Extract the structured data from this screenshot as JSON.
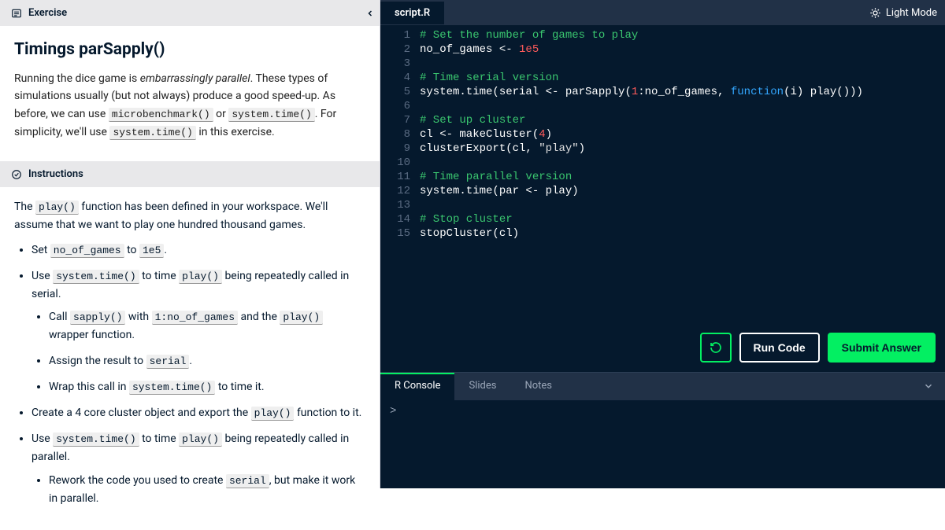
{
  "left": {
    "exercise_label": "Exercise",
    "title": "Timings parSapply()",
    "desc_parts": {
      "p1a": "Running the dice game is ",
      "p1em": "embarrassingly parallel",
      "p1b": ". These types of simulations usually (but not always) produce a good speed-up. As before, we can use ",
      "c1": "microbenchmark()",
      "p1c": " or ",
      "c2": "system.time()",
      "p1d": ". For simplicity, we'll use ",
      "c3": "system.time()",
      "p1e": " in this exercise."
    },
    "instructions_label": "Instructions",
    "intro_a": "The ",
    "intro_c1": "play()",
    "intro_b": " function has been defined in your workspace. We'll assume that we want to play one hundred thousand games.",
    "li1_a": "Set ",
    "li1_c1": "no_of_games",
    "li1_b": " to ",
    "li1_c2": "1e5",
    "li1_c": ".",
    "li2_a": "Use ",
    "li2_c1": "system.time()",
    "li2_b": " to time ",
    "li2_c2": "play()",
    "li2_c": " being repeatedly called in serial.",
    "li2s1_a": "Call ",
    "li2s1_c1": "sapply()",
    "li2s1_b": " with ",
    "li2s1_c2": "1:no_of_games",
    "li2s1_c": " and the ",
    "li2s1_c3": "play()",
    "li2s1_d": " wrapper function.",
    "li2s2_a": "Assign the result to ",
    "li2s2_c1": "serial",
    "li2s2_b": ".",
    "li2s3_a": "Wrap this call in ",
    "li2s3_c1": "system.time()",
    "li2s3_b": " to time it.",
    "li3_a": "Create a 4 core cluster object and export the ",
    "li3_c1": "play()",
    "li3_b": " function to it.",
    "li4_a": "Use ",
    "li4_c1": "system.time()",
    "li4_b": " to time ",
    "li4_c2": "play()",
    "li4_c": " being repeatedly called in parallel.",
    "li4s1_a": "Rework the code you used to create ",
    "li4s1_c1": "serial",
    "li4s1_b": ", but make it work in parallel."
  },
  "editor": {
    "filename": "script.R",
    "light_mode": "Light Mode",
    "lines": [
      [
        {
          "t": "# Set the number of games to play",
          "c": "tok-comment"
        }
      ],
      [
        {
          "t": "no_of_games <- "
        },
        {
          "t": "1e5",
          "c": "tok-num"
        }
      ],
      [],
      [
        {
          "t": "# Time serial version",
          "c": "tok-comment"
        }
      ],
      [
        {
          "t": "system.time(serial <- parSapply("
        },
        {
          "t": "1",
          "c": "tok-num"
        },
        {
          "t": ":no_of_games, "
        },
        {
          "t": "function",
          "c": "tok-kw"
        },
        {
          "t": "(i) play()))"
        }
      ],
      [],
      [
        {
          "t": "# Set up cluster",
          "c": "tok-comment"
        }
      ],
      [
        {
          "t": "cl <- makeCluster("
        },
        {
          "t": "4",
          "c": "tok-num"
        },
        {
          "t": ")"
        }
      ],
      [
        {
          "t": "clusterExport(cl, "
        },
        {
          "t": "\"play\"",
          "c": "tok-str"
        },
        {
          "t": ")"
        }
      ],
      [],
      [
        {
          "t": "# Time parallel version",
          "c": "tok-comment"
        }
      ],
      [
        {
          "t": "system.time(par <- play)"
        }
      ],
      [],
      [
        {
          "t": "# Stop cluster",
          "c": "tok-comment"
        }
      ],
      [
        {
          "t": "stopCluster(cl)"
        }
      ]
    ]
  },
  "actions": {
    "run": "Run Code",
    "submit": "Submit Answer"
  },
  "console": {
    "tabs": [
      "R Console",
      "Slides",
      "Notes"
    ],
    "prompt": ">"
  }
}
